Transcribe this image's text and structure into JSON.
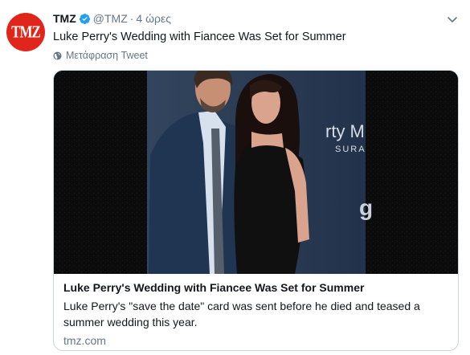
{
  "tweet": {
    "avatar_text": "TMZ",
    "name": "TMZ",
    "handle": "@TMZ",
    "separator": "·",
    "time": "4 ώρες",
    "text": "Luke Perry's Wedding with Fiancee Was Set for Summer",
    "translate_label": "Μετάφραση Tweet"
  },
  "card": {
    "title": "Luke Perry's Wedding with Fiancee Was Set for Summer",
    "description": "Luke Perry's \"save the date\" card was sent before he died and teased a summer wedding this year.",
    "domain": "tmz.com",
    "backdrop_text_1": "rty M",
    "backdrop_text_2": "SURA",
    "backdrop_text_3": "g"
  },
  "colors": {
    "brand_red": "#e0261b",
    "verified_blue": "#1da1f2",
    "secondary_text": "#657786",
    "border": "#ccd6dd"
  },
  "icons": {
    "verified": "verified-badge-icon",
    "menu": "chevron-down-icon",
    "translate": "globe-icon"
  }
}
